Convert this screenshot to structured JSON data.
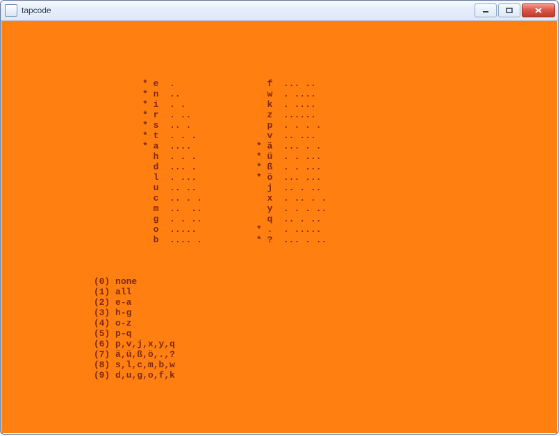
{
  "window": {
    "title": "tapcode"
  },
  "columns": [
    [
      {
        "mark": "*",
        "letter": "e",
        "code": "."
      },
      {
        "mark": "*",
        "letter": "n",
        "code": ".."
      },
      {
        "mark": "*",
        "letter": "i",
        "code": ". ."
      },
      {
        "mark": "*",
        "letter": "r",
        "code": ". .."
      },
      {
        "mark": "*",
        "letter": "s",
        "code": ".. ."
      },
      {
        "mark": "*",
        "letter": "t",
        "code": ". . ."
      },
      {
        "mark": "*",
        "letter": "a",
        "code": "...."
      },
      {
        "mark": " ",
        "letter": "h",
        "code": ". . ."
      },
      {
        "mark": " ",
        "letter": "d",
        "code": "... ."
      },
      {
        "mark": " ",
        "letter": "l",
        "code": ". ..."
      },
      {
        "mark": " ",
        "letter": "u",
        "code": ".. .."
      },
      {
        "mark": " ",
        "letter": "c",
        "code": ".. . ."
      },
      {
        "mark": " ",
        "letter": "m",
        "code": "..  .."
      },
      {
        "mark": " ",
        "letter": "g",
        "code": ". . .."
      },
      {
        "mark": " ",
        "letter": "o",
        "code": "....."
      },
      {
        "mark": " ",
        "letter": "b",
        "code": ".... ."
      }
    ],
    [
      {
        "mark": " ",
        "letter": "f",
        "code": "... .."
      },
      {
        "mark": " ",
        "letter": "w",
        "code": ". ...."
      },
      {
        "mark": " ",
        "letter": "k",
        "code": ". ...."
      },
      {
        "mark": " ",
        "letter": "z",
        "code": "......"
      },
      {
        "mark": " ",
        "letter": "p",
        "code": ". . . ."
      },
      {
        "mark": " ",
        "letter": "v",
        "code": ".. ..."
      },
      {
        "mark": "*",
        "letter": "ä",
        "code": "... . ."
      },
      {
        "mark": "*",
        "letter": "ü",
        "code": ". . ..."
      },
      {
        "mark": "*",
        "letter": "ß",
        "code": ". . ..."
      },
      {
        "mark": "*",
        "letter": "ö",
        "code": "... ..."
      },
      {
        "mark": " ",
        "letter": "j",
        "code": ".. . .."
      },
      {
        "mark": " ",
        "letter": "x",
        "code": ". .. . ."
      },
      {
        "mark": " ",
        "letter": "y",
        "code": ". . . .."
      },
      {
        "mark": " ",
        "letter": "q",
        "code": ".. . .."
      },
      {
        "mark": "*",
        "letter": ".",
        "code": ". ....."
      },
      {
        "mark": "*",
        "letter": "?",
        "code": "... . .."
      }
    ]
  ],
  "menu": [
    {
      "key": "0",
      "label": "none"
    },
    {
      "key": "1",
      "label": "all"
    },
    {
      "key": "2",
      "label": "e-a"
    },
    {
      "key": "3",
      "label": "h-g"
    },
    {
      "key": "4",
      "label": "o-z"
    },
    {
      "key": "5",
      "label": "p-q"
    },
    {
      "key": "6",
      "label": "p,v,j,x,y,q"
    },
    {
      "key": "7",
      "label": "ä,ü,ß,ö,.,?"
    },
    {
      "key": "8",
      "label": "s,l,c,m,b,w"
    },
    {
      "key": "9",
      "label": "d,u,g,o,f,k"
    }
  ],
  "layout": {
    "top_blank_lines": 5,
    "left_indent": 25,
    "letter_gap": 2,
    "col1_code_width": 10,
    "between_cols_gap": 6,
    "gap_before_menu": 3,
    "menu_indent": 16
  }
}
